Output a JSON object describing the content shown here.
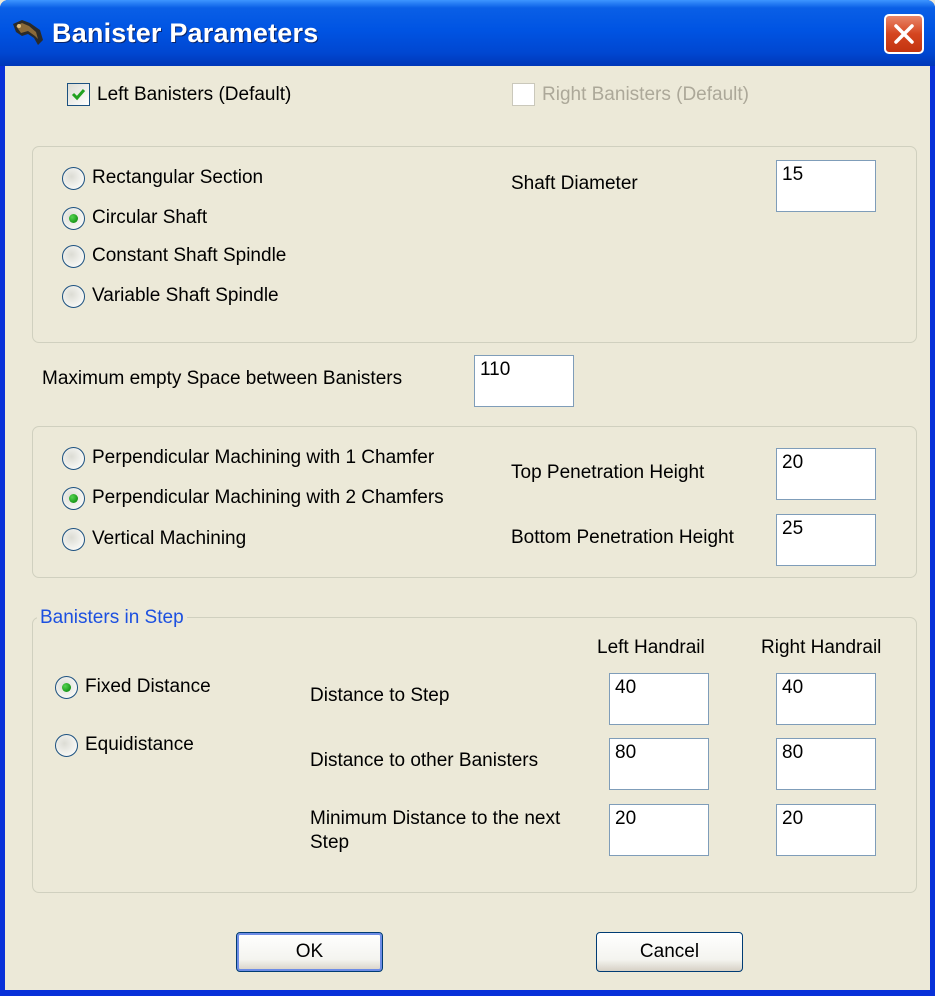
{
  "window": {
    "title": "Banister Parameters"
  },
  "top": {
    "left_banisters": {
      "label": "Left Banisters (Default)",
      "checked": true
    },
    "right_banisters": {
      "label": "Right Banisters (Default)",
      "checked": false,
      "disabled": true
    }
  },
  "shaft_type": {
    "options": [
      {
        "label": "Rectangular Section",
        "selected": false
      },
      {
        "label": "Circular Shaft",
        "selected": true
      },
      {
        "label": "Constant Shaft Spindle",
        "selected": false
      },
      {
        "label": "Variable Shaft Spindle",
        "selected": false
      }
    ],
    "shaft_diameter_label": "Shaft Diameter",
    "shaft_diameter_value": "15"
  },
  "max_space": {
    "label": "Maximum empty Space between Banisters",
    "value": "110"
  },
  "machining": {
    "options": [
      {
        "label": "Perpendicular Machining with 1 Chamfer",
        "selected": false
      },
      {
        "label": "Perpendicular Machining with 2 Chamfers",
        "selected": true
      },
      {
        "label": "Vertical Machining",
        "selected": false
      }
    ],
    "top_penetration_label": "Top Penetration Height",
    "top_penetration_value": "20",
    "bottom_penetration_label": "Bottom Penetration Height",
    "bottom_penetration_value": "25"
  },
  "step": {
    "title": "Banisters in Step",
    "left_header": "Left Handrail",
    "right_header": "Right Handrail",
    "modes": [
      {
        "label": "Fixed Distance",
        "selected": true
      },
      {
        "label": "Equidistance",
        "selected": false
      }
    ],
    "rows": [
      {
        "label": "Distance to Step",
        "left": "40",
        "right": "40"
      },
      {
        "label": "Distance to other Banisters",
        "left": "80",
        "right": "80"
      },
      {
        "label_line1": "Minimum Distance to the next",
        "label_line2": "Step",
        "left": "20",
        "right": "20"
      }
    ]
  },
  "buttons": {
    "ok": "OK",
    "cancel": "Cancel"
  },
  "colors": {
    "titlebar": "#0054e3",
    "dialog_bg": "#ece9d8",
    "group_title": "#1c50e0",
    "radio_dot": "#21a121"
  }
}
